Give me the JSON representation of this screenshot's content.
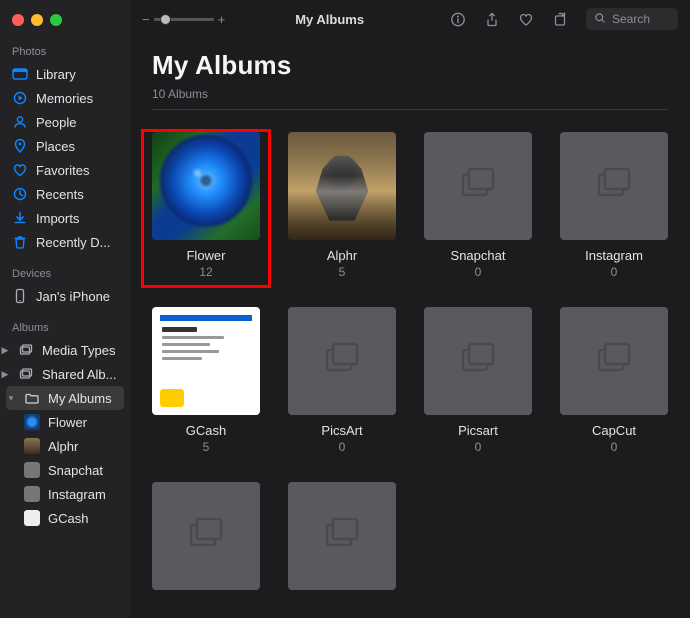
{
  "topbar": {
    "title": "My Albums",
    "search_placeholder": "Search"
  },
  "sidebar": {
    "photos_heading": "Photos",
    "photos": [
      {
        "label": "Library"
      },
      {
        "label": "Memories"
      },
      {
        "label": "People"
      },
      {
        "label": "Places"
      },
      {
        "label": "Favorites"
      },
      {
        "label": "Recents"
      },
      {
        "label": "Imports"
      },
      {
        "label": "Recently D..."
      }
    ],
    "devices_heading": "Devices",
    "devices": [
      {
        "label": "Jan's iPhone"
      }
    ],
    "albums_heading": "Albums",
    "albums_tree": [
      {
        "label": "Media Types"
      },
      {
        "label": "Shared Alb..."
      },
      {
        "label": "My Albums",
        "selected": true
      }
    ],
    "my_albums_children": [
      {
        "label": "Flower"
      },
      {
        "label": "Alphr"
      },
      {
        "label": "Snapchat"
      },
      {
        "label": "Instagram"
      },
      {
        "label": "GCash"
      }
    ]
  },
  "main": {
    "heading": "My Albums",
    "subheading": "10 Albums",
    "albums": [
      {
        "name": "Flower",
        "count": "12",
        "thumb": "rose",
        "highlight": true
      },
      {
        "name": "Alphr",
        "count": "5",
        "thumb": "alphr"
      },
      {
        "name": "Snapchat",
        "count": "0",
        "thumb": "empty"
      },
      {
        "name": "Instagram",
        "count": "0",
        "thumb": "empty"
      },
      {
        "name": "GCash",
        "count": "5",
        "thumb": "gcash"
      },
      {
        "name": "PicsArt",
        "count": "0",
        "thumb": "empty"
      },
      {
        "name": "Picsart",
        "count": "0",
        "thumb": "empty"
      },
      {
        "name": "CapCut",
        "count": "0",
        "thumb": "empty"
      },
      {
        "name": "",
        "count": "",
        "thumb": "empty"
      },
      {
        "name": "",
        "count": "",
        "thumb": "empty"
      }
    ]
  }
}
